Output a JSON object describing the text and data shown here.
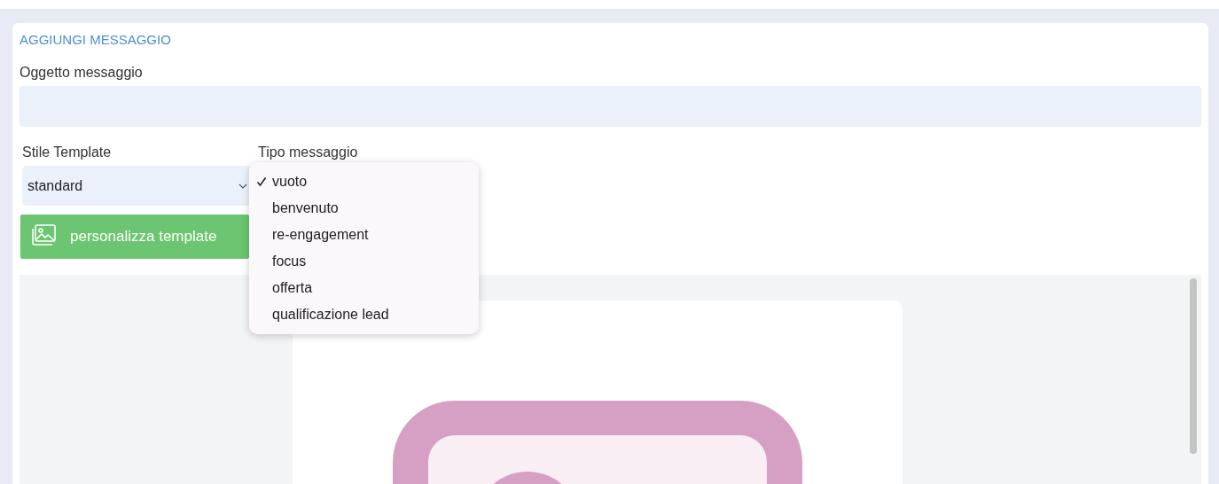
{
  "title": "AGGIUNGI MESSAGGIO",
  "subject": {
    "label": "Oggetto messaggio"
  },
  "template_style": {
    "label": "Stile Template",
    "value": "standard"
  },
  "message_type": {
    "label": "Tipo messaggio",
    "options": [
      {
        "label": "vuoto",
        "selected": true
      },
      {
        "label": "benvenuto",
        "selected": false
      },
      {
        "label": "re-engagement",
        "selected": false
      },
      {
        "label": "focus",
        "selected": false
      },
      {
        "label": "offerta",
        "selected": false
      },
      {
        "label": "qualificazione lead",
        "selected": false
      }
    ]
  },
  "customize_button": {
    "label": "personalizza template"
  }
}
